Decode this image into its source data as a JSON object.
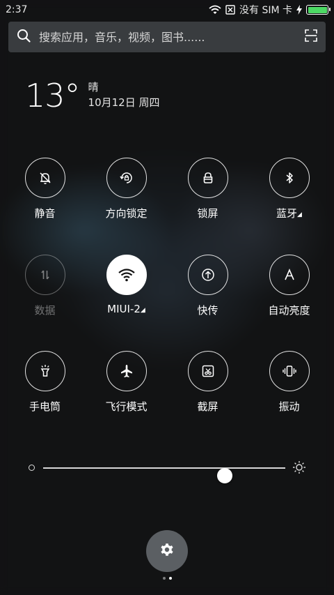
{
  "status_bar": {
    "time": "2:37",
    "carrier": "没有 SIM 卡",
    "icons": [
      "wifi-icon",
      "no-sim-icon",
      "charging-icon",
      "battery-icon"
    ],
    "battery_level": 1.0
  },
  "search": {
    "placeholder": "搜索应用，音乐，视频，图书......",
    "icons": [
      "search-icon",
      "scan-icon"
    ]
  },
  "weather": {
    "temperature": "13°",
    "condition": "晴",
    "date": "10月12日 周四"
  },
  "toggles": [
    {
      "label": "静音",
      "icon": "mute-bell-icon",
      "state": "off",
      "has_more": false
    },
    {
      "label": "方向锁定",
      "icon": "rotation-lock-icon",
      "state": "off",
      "has_more": false
    },
    {
      "label": "锁屏",
      "icon": "lock-icon",
      "state": "off",
      "has_more": false
    },
    {
      "label": "蓝牙",
      "icon": "bluetooth-icon",
      "state": "off",
      "has_more": true
    },
    {
      "label": "数据",
      "icon": "mobile-data-icon",
      "state": "disabled",
      "has_more": false
    },
    {
      "label": "MIUI-2",
      "icon": "wifi-icon",
      "state": "on",
      "has_more": true
    },
    {
      "label": "快传",
      "icon": "quick-transfer-icon",
      "state": "off",
      "has_more": false
    },
    {
      "label": "自动亮度",
      "icon": "auto-brightness-icon",
      "state": "off",
      "has_more": false
    },
    {
      "label": "手电筒",
      "icon": "flashlight-icon",
      "state": "off",
      "has_more": false
    },
    {
      "label": "飞行模式",
      "icon": "airplane-icon",
      "state": "off",
      "has_more": false
    },
    {
      "label": "截屏",
      "icon": "screenshot-icon",
      "state": "off",
      "has_more": false
    },
    {
      "label": "振动",
      "icon": "vibrate-icon",
      "state": "off",
      "has_more": false
    }
  ],
  "brightness": {
    "level": 0.75,
    "min_icon": "brightness-low-icon",
    "max_icon": "brightness-high-icon"
  },
  "settings_button": {
    "icon": "gear-icon"
  },
  "pager": {
    "count": 2,
    "active_index": 1
  },
  "colors": {
    "active_toggle": "#ffffff",
    "battery": "#4cd964",
    "settings_button": "#5b5f63"
  }
}
